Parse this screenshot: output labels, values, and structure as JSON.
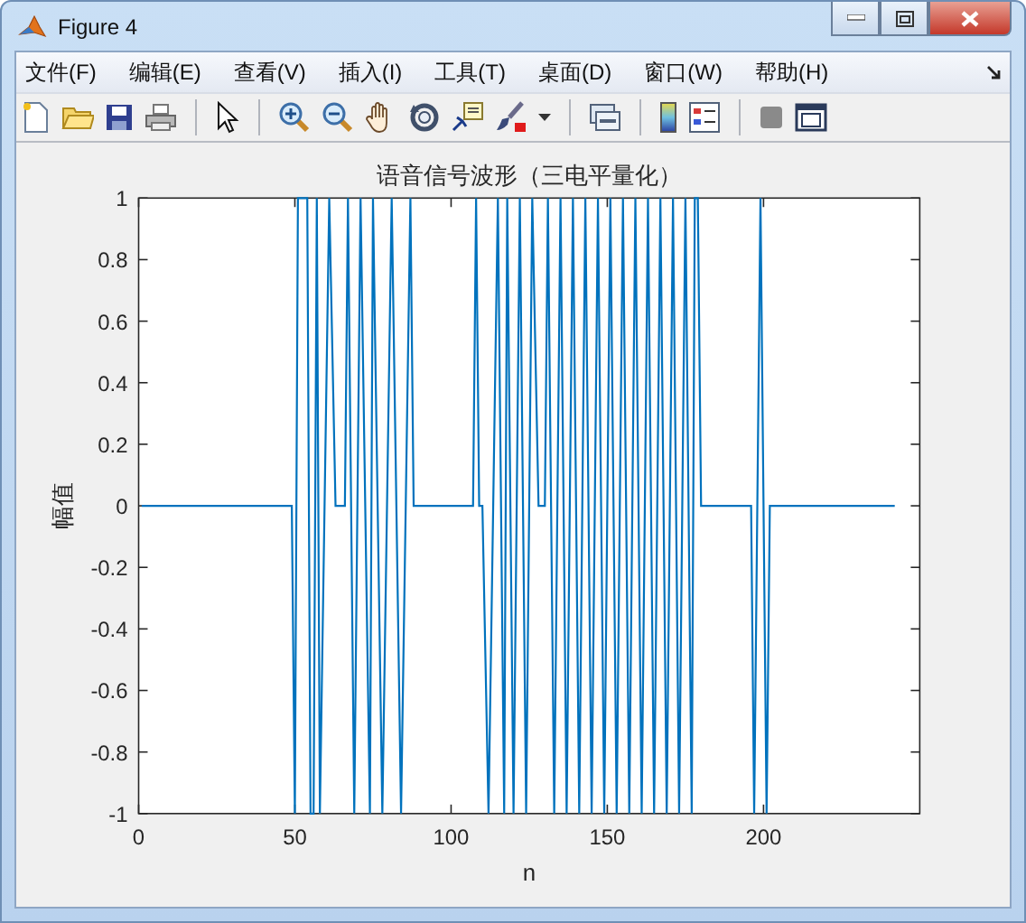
{
  "window": {
    "title": "Figure 4"
  },
  "menu": [
    {
      "label": "文件(F)"
    },
    {
      "label": "编辑(E)"
    },
    {
      "label": "查看(V)"
    },
    {
      "label": "插入(I)"
    },
    {
      "label": "工具(T)"
    },
    {
      "label": "桌面(D)"
    },
    {
      "label": "窗口(W)"
    },
    {
      "label": "帮助(H)"
    }
  ],
  "figure": {
    "chart_data": {
      "type": "line",
      "title": "语音信号波形（三电平量化）",
      "xlabel": "n",
      "ylabel": "幅值",
      "xlim": [
        0,
        250
      ],
      "ylim": [
        -1,
        1
      ],
      "xticks": [
        0,
        50,
        100,
        150,
        200
      ],
      "yticks": [
        {
          "value": -1,
          "label": "-1"
        },
        {
          "value": -0.8,
          "label": "-0.8"
        },
        {
          "value": -0.6,
          "label": "-0.6"
        },
        {
          "value": -0.4,
          "label": "-0.4"
        },
        {
          "value": -0.2,
          "label": "-0.2"
        },
        {
          "value": 0,
          "label": "0"
        },
        {
          "value": 0.2,
          "label": "0.2"
        },
        {
          "value": 0.4,
          "label": "0.4"
        },
        {
          "value": 0.6,
          "label": "0.6"
        },
        {
          "value": 0.8,
          "label": "0.8"
        },
        {
          "value": 1,
          "label": "1"
        }
      ],
      "x": [
        1,
        49,
        50,
        51,
        54,
        55,
        56,
        57,
        58,
        61,
        63,
        66,
        67,
        69,
        71,
        74,
        75,
        78,
        81,
        84,
        87,
        88,
        107,
        108,
        109,
        110,
        112,
        115,
        117,
        118,
        120,
        122,
        124,
        126,
        128,
        130,
        131,
        133,
        135,
        137,
        139,
        141,
        143,
        145,
        147,
        149,
        151,
        153,
        155,
        157,
        159,
        161,
        163,
        165,
        167,
        169,
        171,
        173,
        175,
        177,
        178,
        179,
        180,
        196,
        197,
        199,
        201,
        202,
        242
      ],
      "series": [
        {
          "color": "#0072bd",
          "values": [
            0,
            0,
            -1,
            1,
            1,
            -1,
            -1,
            1,
            -1,
            1,
            0,
            0,
            1,
            -1,
            1,
            -1,
            1,
            -1,
            1,
            -1,
            1,
            0,
            0,
            1,
            0,
            0,
            -1,
            1,
            -1,
            1,
            -1,
            1,
            -1,
            1,
            0,
            0,
            1,
            -1,
            1,
            -1,
            1,
            -1,
            1,
            -1,
            1,
            -1,
            1,
            -1,
            1,
            -1,
            1,
            -1,
            1,
            -1,
            1,
            -1,
            1,
            -1,
            1,
            -1,
            1,
            1,
            0,
            0,
            -1,
            1,
            -1,
            0,
            0
          ]
        }
      ]
    }
  }
}
